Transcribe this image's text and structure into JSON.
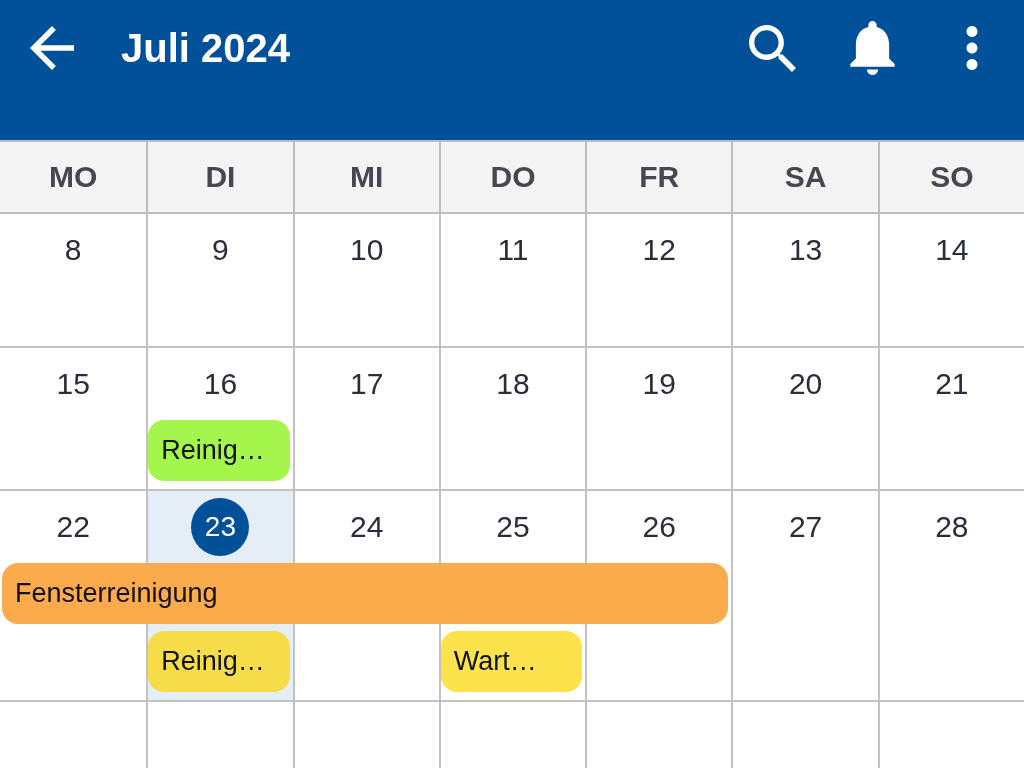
{
  "app_bar": {
    "title": "Juli 2024"
  },
  "weekdays": [
    "MO",
    "DI",
    "MI",
    "DO",
    "FR",
    "SA",
    "SO"
  ],
  "weeks": [
    {
      "days": [
        {
          "number": "8",
          "today": false
        },
        {
          "number": "9",
          "today": false
        },
        {
          "number": "10",
          "today": false
        },
        {
          "number": "11",
          "today": false
        },
        {
          "number": "12",
          "today": false
        },
        {
          "number": "13",
          "today": false
        },
        {
          "number": "14",
          "today": false
        }
      ]
    },
    {
      "days": [
        {
          "number": "15",
          "today": false
        },
        {
          "number": "16",
          "today": false,
          "events": [
            {
              "title": "Reinig…",
              "color": "#a4f64c"
            }
          ]
        },
        {
          "number": "17",
          "today": false
        },
        {
          "number": "18",
          "today": false
        },
        {
          "number": "19",
          "today": false
        },
        {
          "number": "20",
          "today": false
        },
        {
          "number": "21",
          "today": false
        }
      ]
    },
    {
      "days": [
        {
          "number": "22",
          "today": false,
          "span": {
            "kind": "start",
            "title": "Fensterreinigung",
            "color": "#fcab4c"
          }
        },
        {
          "number": "23",
          "today": true,
          "span": {
            "kind": "continue"
          },
          "events": [
            {
              "title": "Reinig…",
              "color": "#f7dc4a"
            }
          ]
        },
        {
          "number": "24",
          "today": false,
          "span": {
            "kind": "continue"
          }
        },
        {
          "number": "25",
          "today": false,
          "span": {
            "kind": "continue"
          },
          "events": [
            {
              "title": "Wart…",
              "color": "#fde34b"
            }
          ]
        },
        {
          "number": "26",
          "today": false,
          "span": {
            "kind": "continue"
          }
        },
        {
          "number": "27",
          "today": false
        },
        {
          "number": "28",
          "today": false
        }
      ]
    }
  ]
}
